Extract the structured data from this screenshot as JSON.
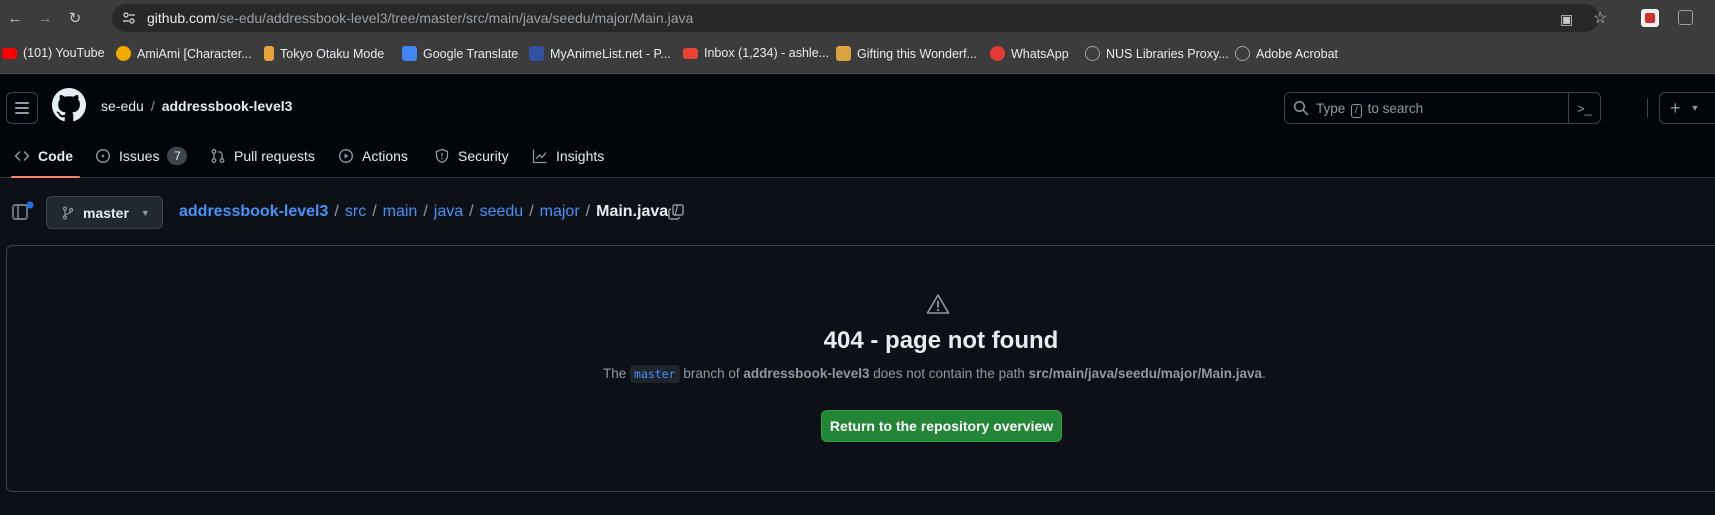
{
  "browser": {
    "url_host": "github.com",
    "url_path": "/se-edu/addressbook-level3/tree/master/src/main/java/seedu/major/Main.java",
    "bookmarks": [
      {
        "label": "(101) YouTube",
        "icon": "youtube-icon",
        "color": "#ff0000"
      },
      {
        "label": "AmiAmi [Character...",
        "icon": "amiami-icon",
        "color": "#f2a900"
      },
      {
        "label": "Tokyo Otaku Mode",
        "icon": "tokyo-otaku-icon",
        "color": "#e8a33d"
      },
      {
        "label": "Google Translate",
        "icon": "translate-icon",
        "color": "#4285f4"
      },
      {
        "label": "MyAnimeList.net - P...",
        "icon": "mal-icon",
        "color": "#2e51a2"
      },
      {
        "label": "Inbox (1,234) - ashle...",
        "icon": "gmail-icon",
        "color": "#ea4335"
      },
      {
        "label": "Gifting this Wonderf...",
        "icon": "gift-icon",
        "color": "#d9a441"
      },
      {
        "label": "WhatsApp",
        "icon": "whatsapp-icon",
        "color": "#e53935"
      },
      {
        "label": "NUS Libraries Proxy...",
        "icon": "globe-icon",
        "color": "#9aa0a6"
      },
      {
        "label": "Adobe Acrobat",
        "icon": "globe-icon",
        "color": "#9aa0a6"
      }
    ]
  },
  "header": {
    "owner": "se-edu",
    "separator": "/",
    "repo": "addressbook-level3",
    "search_prefix": "Type",
    "search_key": "/",
    "search_suffix": "to search"
  },
  "tabs": [
    {
      "label": "Code",
      "icon": "code-icon",
      "active": true
    },
    {
      "label": "Issues",
      "icon": "issue-icon",
      "count": "7"
    },
    {
      "label": "Pull requests",
      "icon": "pull-request-icon"
    },
    {
      "label": "Actions",
      "icon": "play-icon"
    },
    {
      "label": "Security",
      "icon": "shield-icon"
    },
    {
      "label": "Insights",
      "icon": "graph-icon"
    }
  ],
  "breadcrumb": {
    "branch": "master",
    "parts": [
      "addressbook-level3",
      "src",
      "main",
      "java",
      "seedu",
      "major"
    ],
    "current": "Main.java",
    "sep": "/"
  },
  "error": {
    "title": "404 - page not found",
    "desc_the": "The",
    "branch": "master",
    "desc_branch_of": "branch of",
    "repo": "addressbook-level3",
    "desc_not_contain": "does not contain the path",
    "path": "src/main/java/seedu/major/Main.java",
    "desc_end": ".",
    "button": "Return to the repository overview"
  },
  "colors": {
    "accent_link": "#4493f8",
    "tab_underline": "#f78166",
    "button_green": "#238636"
  }
}
